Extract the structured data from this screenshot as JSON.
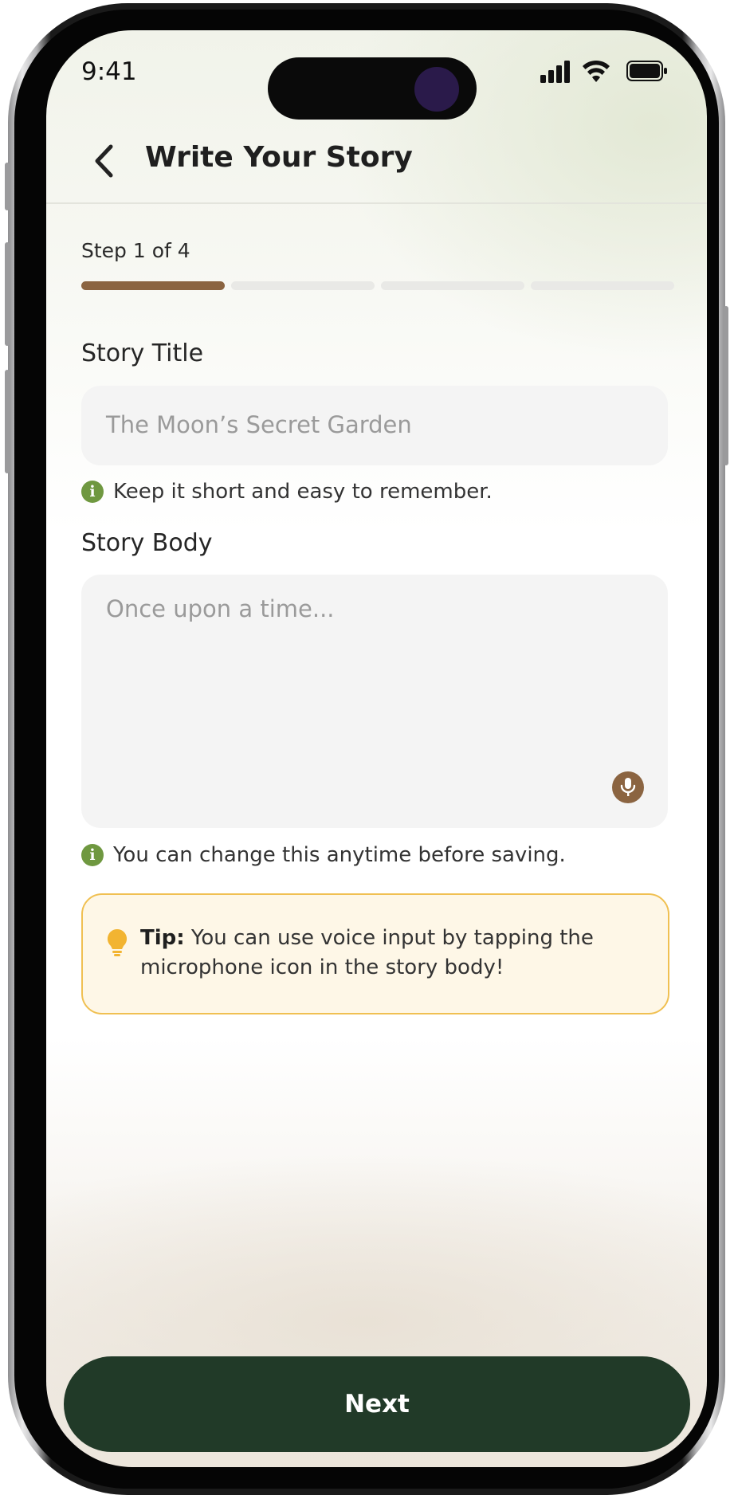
{
  "status_bar": {
    "time": "9:41"
  },
  "header": {
    "title": "Write Your Story"
  },
  "progress": {
    "label": "Step 1 of 4",
    "current_step": 1,
    "total_steps": 4
  },
  "story_title": {
    "label": "Story Title",
    "placeholder": "The Moon’s Secret Garden",
    "hint": "Keep it short and easy to remember."
  },
  "story_body": {
    "label": "Story Body",
    "placeholder": "Once upon a time...",
    "hint": "You can change this anytime before saving."
  },
  "tip": {
    "prefix": "Tip:",
    "text": " You can use voice input by tapping the microphone icon in the story body!"
  },
  "footer": {
    "next_label": "Next"
  },
  "colors": {
    "accent_brown": "#8b6441",
    "hint_green": "#6f9840",
    "button_green": "#213a28",
    "tip_background": "#fef7e7",
    "tip_border": "#f0c052"
  }
}
